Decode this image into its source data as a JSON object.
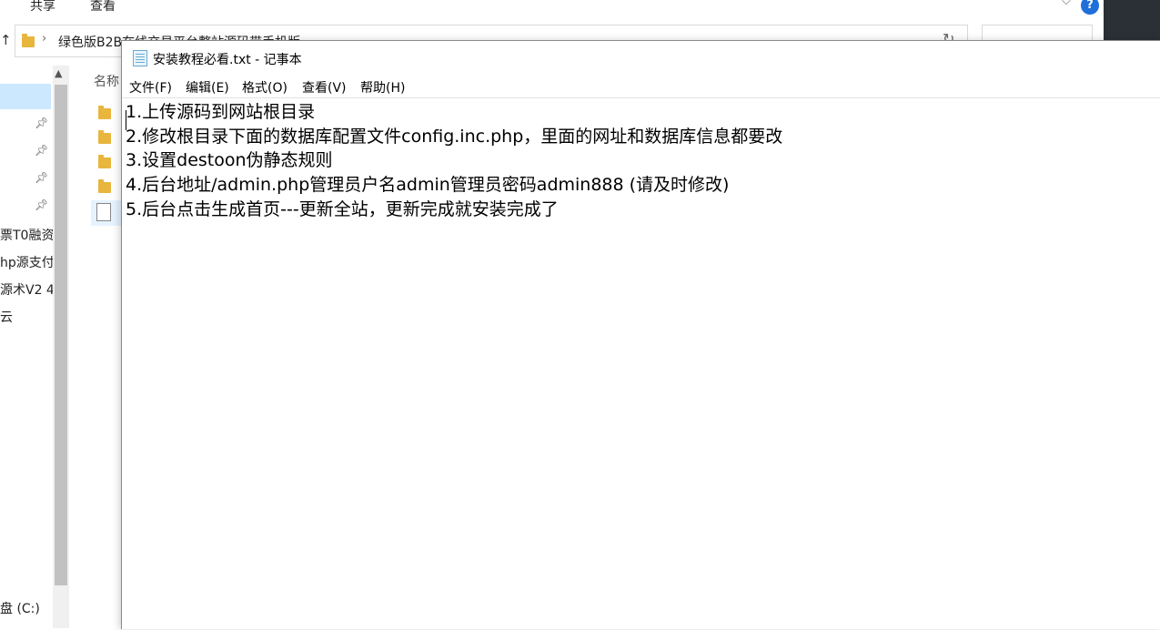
{
  "explorer": {
    "ribbon_tabs": [
      "共享",
      "查看"
    ],
    "path": "绿色版B2B在线交易平台整站源码带手机版",
    "column_name": "名称",
    "nav_items": [
      "票T0融资",
      "hp源支付",
      "源术V2 4.",
      "云"
    ],
    "drive": "盘 (C:)",
    "help_label": "?"
  },
  "notepad": {
    "title": "安装教程必看.txt - 记事本",
    "menu": [
      "文件(F)",
      "编辑(E)",
      "格式(O)",
      "查看(V)",
      "帮助(H)"
    ],
    "lines": [
      "1.上传源码到网站根目录",
      "2.修改根目录下面的数据库配置文件config.inc.php，里面的网址和数据库信息都要改",
      "3.设置destoon伪静态规则",
      "4.后台地址/admin.php管理员户名admin管理员密码admin888 (请及时修改)",
      "5.后台点击生成首页---更新全站，更新完成就安装完成了"
    ]
  }
}
